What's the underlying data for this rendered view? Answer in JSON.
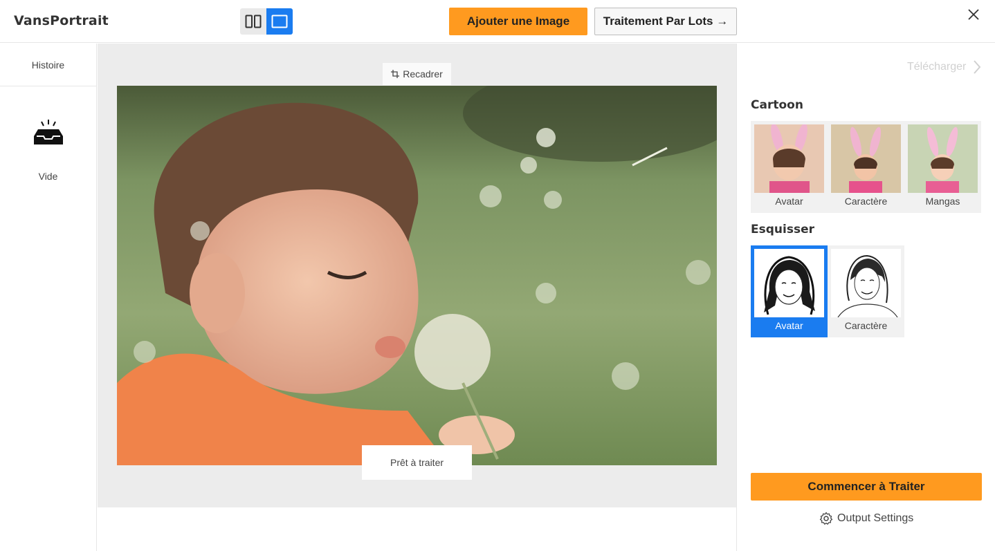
{
  "header": {
    "logo": "VansPortrait",
    "add_image_label": "Ajouter une Image",
    "batch_label": "Traitement Par Lots →"
  },
  "sidebar": {
    "history_label": "Histoire",
    "empty_label": "Vide"
  },
  "canvas": {
    "crop_label": "Recadrer",
    "status_label": "Prêt à traiter"
  },
  "right_panel": {
    "download_label": "Télécharger",
    "cartoon": {
      "title": "Cartoon",
      "styles": [
        {
          "label": "Avatar"
        },
        {
          "label": "Caractère"
        },
        {
          "label": "Mangas"
        }
      ]
    },
    "sketch": {
      "title": "Esquisser",
      "styles": [
        {
          "label": "Avatar",
          "selected": true
        },
        {
          "label": "Caractère",
          "selected": false
        }
      ]
    },
    "start_label": "Commencer à Traiter",
    "output_settings_label": "Output Settings"
  },
  "colors": {
    "accent_orange": "#ff9a1f",
    "accent_blue": "#1a7cf0",
    "canvas_bg": "#ececec"
  }
}
